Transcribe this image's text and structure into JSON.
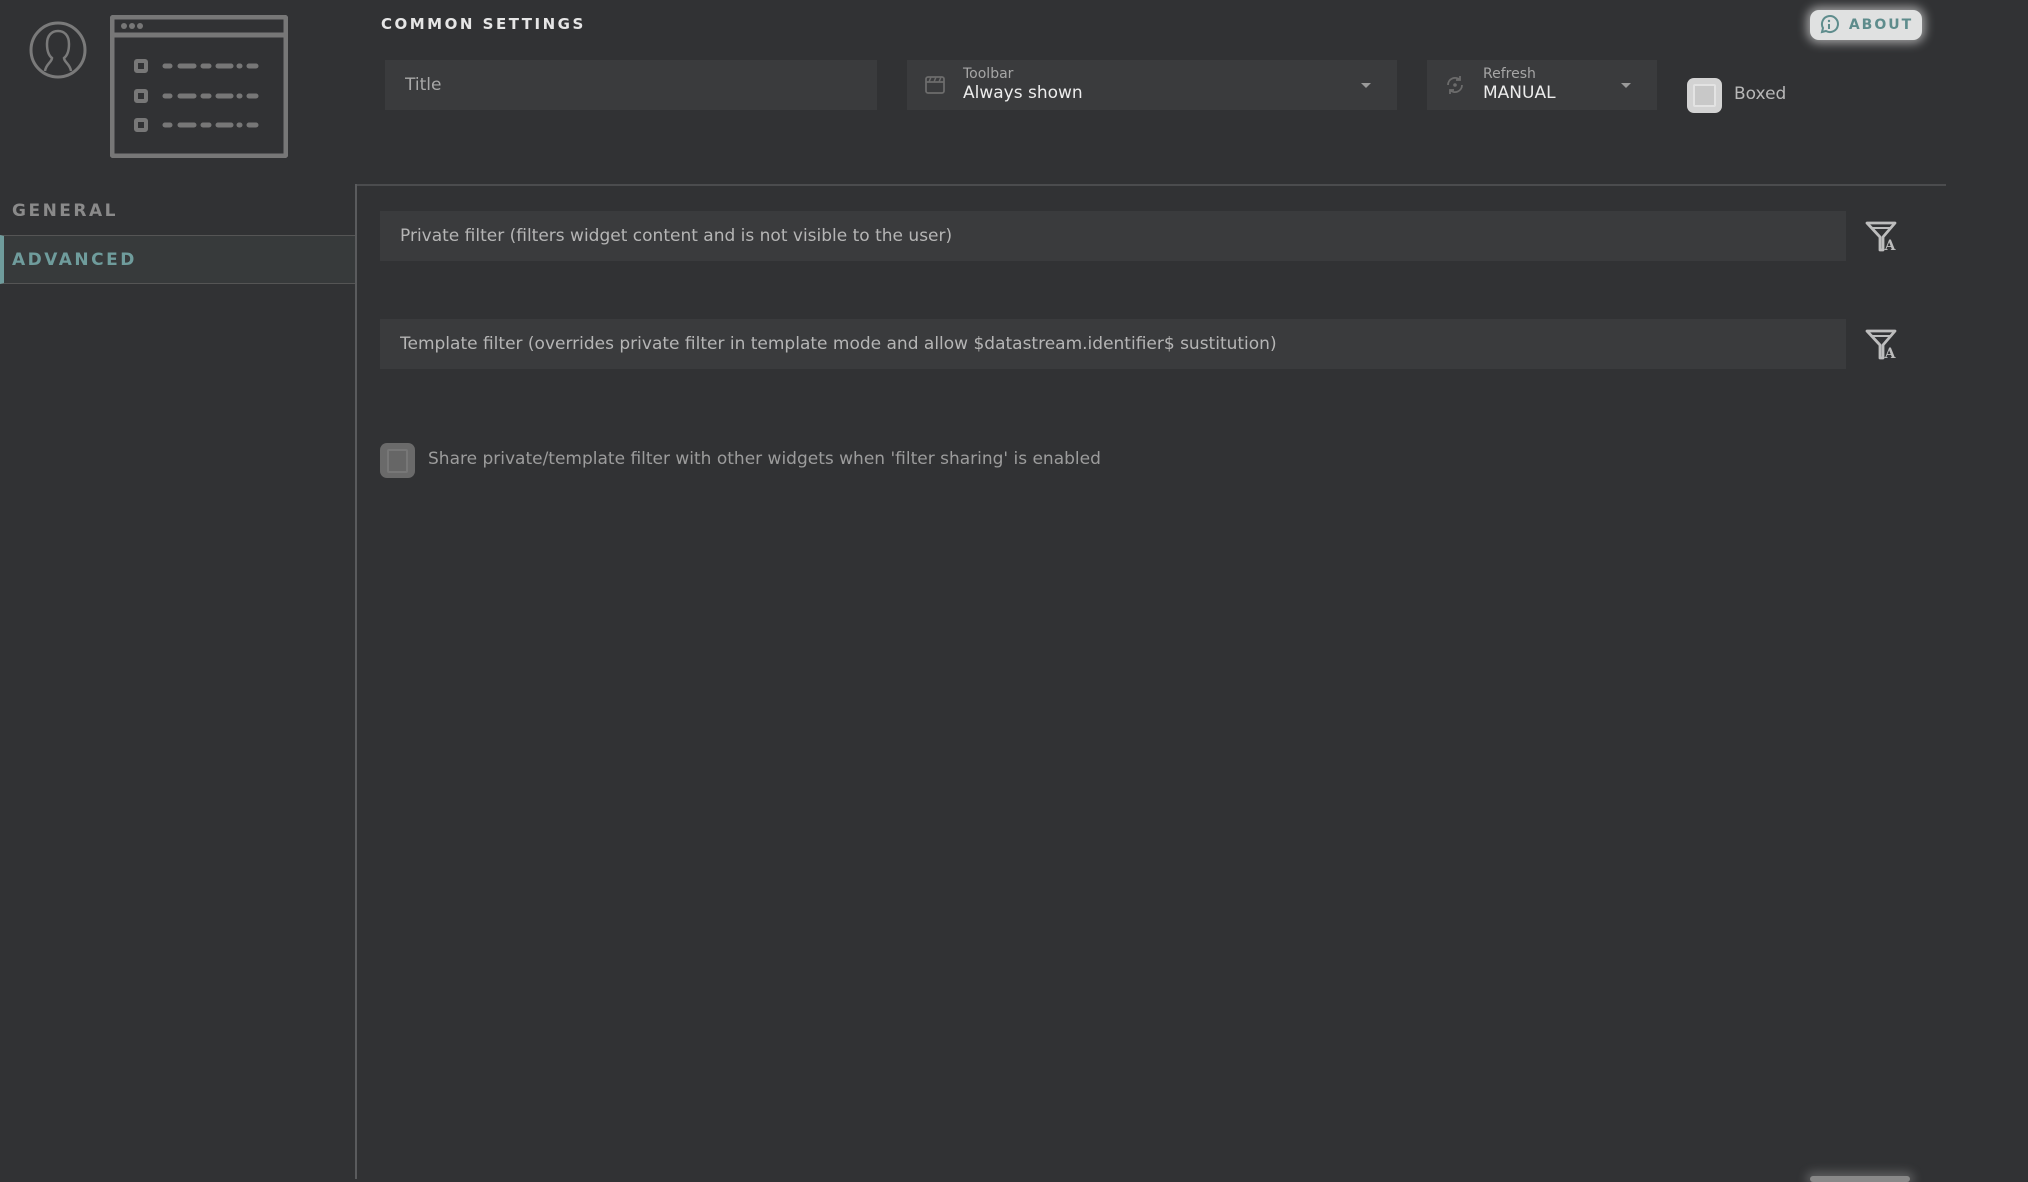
{
  "header": {
    "section_title": "COMMON SETTINGS",
    "about_label": "ABOUT",
    "title_field": {
      "value": "",
      "placeholder": "Title"
    },
    "toolbar_select": {
      "label": "Toolbar",
      "value": "Always shown",
      "icon": "clapperboard-icon"
    },
    "refresh_select": {
      "label": "Refresh",
      "value": "MANUAL",
      "icon": "refresh-icon"
    },
    "boxed": {
      "label": "Boxed",
      "checked": false
    }
  },
  "sidebar": {
    "items": [
      {
        "label": "GENERAL",
        "active": false
      },
      {
        "label": "ADVANCED",
        "active": true
      }
    ]
  },
  "advanced": {
    "private_filter": {
      "value": "",
      "placeholder": "Private filter (filters widget content and is not visible to the user)"
    },
    "template_filter": {
      "value": "",
      "placeholder": "Template filter (overrides private filter in template mode and allow $datastream.identifier$ sustitution)"
    },
    "share_filter": {
      "label": "Share private/template filter with other widgets when 'filter sharing' is enabled",
      "checked": false
    }
  },
  "colors": {
    "background": "#313234",
    "accent": "#6f9c9c",
    "field_background": "#3a3b3d"
  }
}
